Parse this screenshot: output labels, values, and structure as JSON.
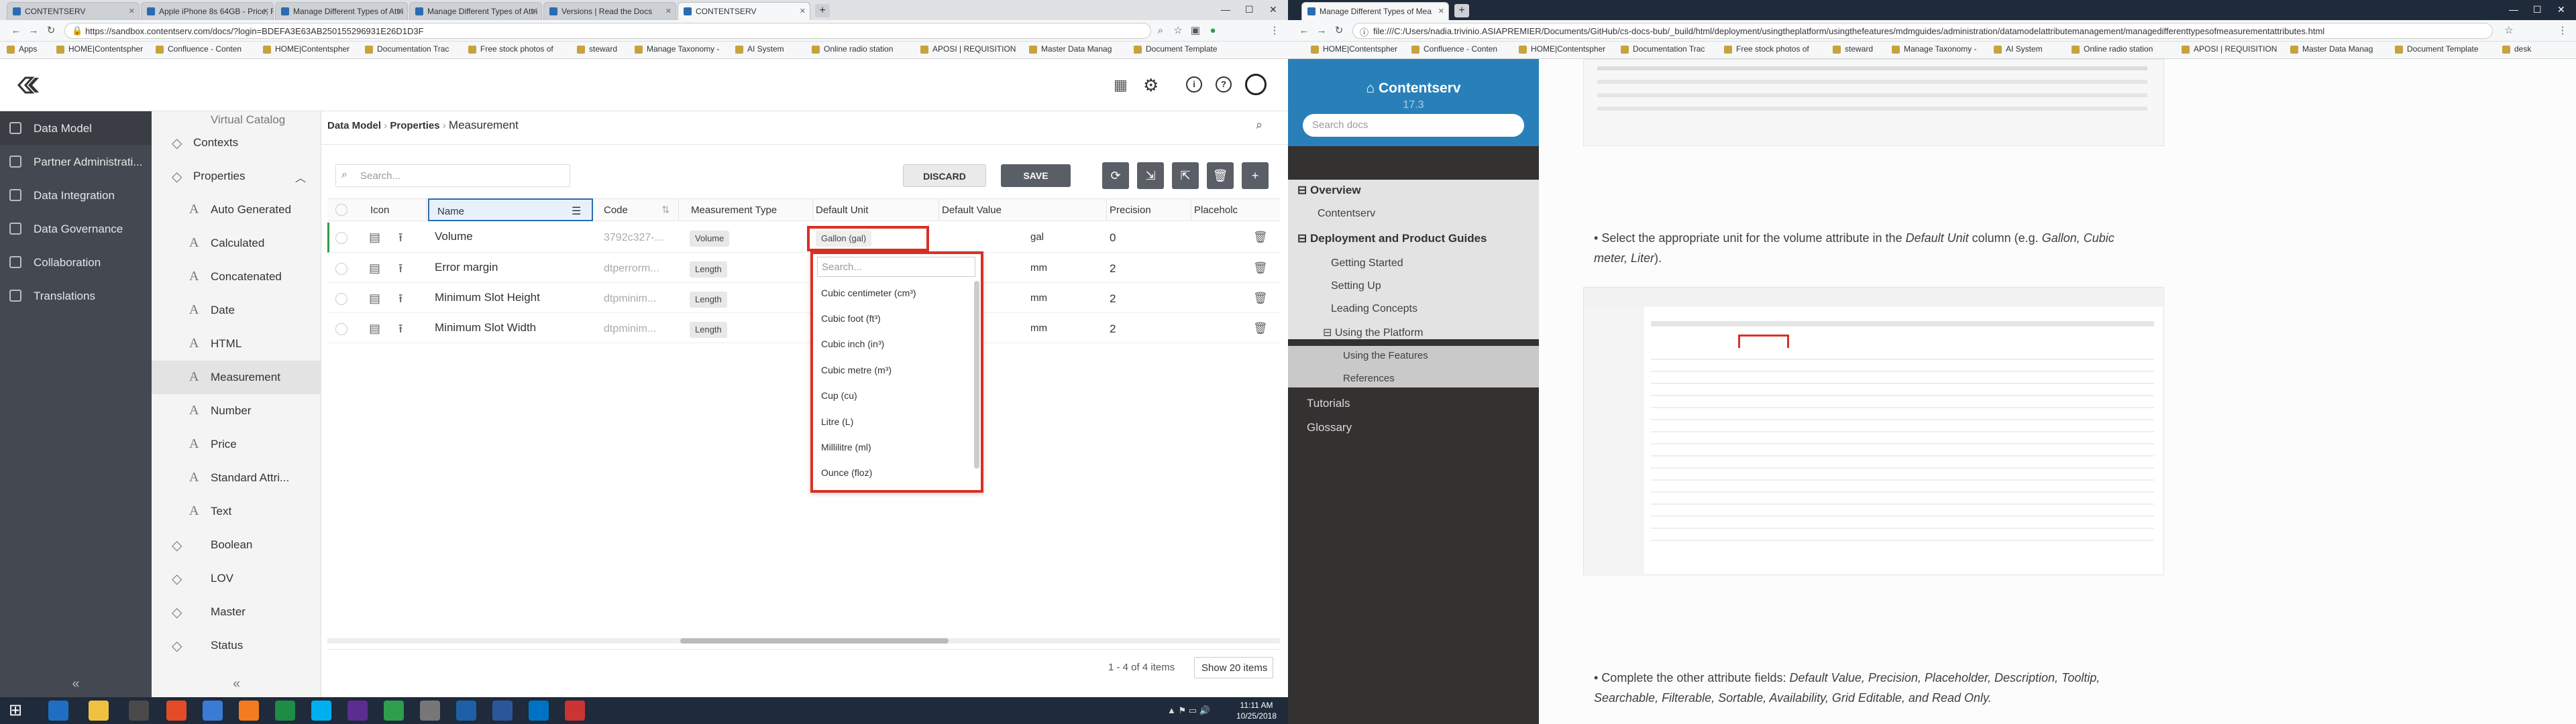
{
  "left_browser": {
    "tabs": [
      {
        "label": "CONTENTSERV"
      },
      {
        "label": "Apple iPhone 8s 64GB - Price, Fe"
      },
      {
        "label": "Manage Different Types of Attri"
      },
      {
        "label": "Manage Different Types of Attri"
      },
      {
        "label": "Versions | Read the Docs"
      },
      {
        "label": "CONTENTSERV"
      }
    ],
    "url": "https://sandbox.contentserv.com/docs/?login=BDEFA3E63AB250155296931E26D1D3F",
    "bookmarks": [
      "Apps",
      "HOME|Contentspher",
      "Confluence - Conten",
      "HOME|Contentspher",
      "Documentation Trac",
      "Free stock photos of",
      "steward",
      "Manage Taxonomy -",
      "AI System",
      "Online radio station",
      "APOSI | REQUISITION",
      "Master Data Manag",
      "Document Template"
    ]
  },
  "app": {
    "nav": [
      {
        "label": "Data Model",
        "active": true
      },
      {
        "label": "Partner Administrati..."
      },
      {
        "label": "Data Integration"
      },
      {
        "label": "Data Governance"
      },
      {
        "label": "Collaboration"
      },
      {
        "label": "Translations"
      }
    ],
    "tree": [
      {
        "label": "Virtual Catalog"
      },
      {
        "label": "Contexts"
      },
      {
        "label": "Properties"
      },
      {
        "label": "Auto Generated"
      },
      {
        "label": "Calculated"
      },
      {
        "label": "Concatenated"
      },
      {
        "label": "Date"
      },
      {
        "label": "HTML"
      },
      {
        "label": "Measurement",
        "active": true
      },
      {
        "label": "Number"
      },
      {
        "label": "Price"
      },
      {
        "label": "Standard Attri..."
      },
      {
        "label": "Text"
      },
      {
        "label": "Boolean"
      },
      {
        "label": "LOV"
      },
      {
        "label": "Master"
      },
      {
        "label": "Status"
      }
    ],
    "breadcrumb": [
      "Data Model",
      "Properties",
      "Measurement"
    ],
    "search_placeholder": "Search...",
    "discard_label": "DISCARD",
    "save_label": "SAVE",
    "columns": [
      "Icon",
      "Name",
      "Code",
      "Measurement Type",
      "Default Unit",
      "Default Value",
      "Precision",
      "Placeholc"
    ],
    "rows": [
      {
        "name": "Volume",
        "code": "3792c327-...",
        "type": "Volume",
        "unit": "Gallon (gal)",
        "default": "gal",
        "precision": "0"
      },
      {
        "name": "Error margin",
        "code": "dtperrorm...",
        "type": "Length",
        "unit": "",
        "default": "mm",
        "precision": "2"
      },
      {
        "name": "Minimum Slot Height",
        "code": "dtpminim...",
        "type": "Length",
        "unit": "",
        "default": "mm",
        "precision": "2"
      },
      {
        "name": "Minimum Slot Width",
        "code": "dtpminim...",
        "type": "Length",
        "unit": "",
        "default": "mm",
        "precision": "2"
      }
    ],
    "dropdown": {
      "placeholder": "Search...",
      "options": [
        "Cubic centimeter (cm³)",
        "Cubic foot (ft³)",
        "Cubic inch (in³)",
        "Cubic metre (m³)",
        "Cup (cu)",
        "Litre (L)",
        "Millilitre (ml)",
        "Ounce (floz)"
      ]
    },
    "pagination": "1 - 4 of 4 items",
    "page_size": "Show 20 items",
    "clock": {
      "time": "11:11 AM",
      "date": "10/25/2018"
    }
  },
  "right_browser": {
    "tab_label": "Manage Different Types of Mea",
    "url": "file:///C:/Users/nadia.trivinio.ASIAPREMIER/Documents/GitHub/cs-docs-bub/_build/html/deployment/usingtheplatform/usingthefeatures/mdmguides/administration/datamodelattributemanagement/managedifferenttypesofmeasurementattributes.html",
    "bookmarks": [
      "HOME|Contentspher",
      "Confluence - Conten",
      "HOME|Contentspher",
      "Documentation Trac",
      "Free stock photos of",
      "steward",
      "Manage Taxonomy -",
      "AI System",
      "Online radio station",
      "APOSI | REQUISITION",
      "Master Data Manag",
      "Document Template",
      "desk"
    ]
  },
  "docs": {
    "brand": "Contentserv",
    "version": "17.3",
    "search_placeholder": "Search docs",
    "nav": [
      {
        "label": "Overview",
        "level": 0
      },
      {
        "label": "Contentserv",
        "level": 1
      },
      {
        "label": "Deployment and Product Guides",
        "level": 0
      },
      {
        "label": "Getting Started",
        "level": 1
      },
      {
        "label": "Setting Up",
        "level": 1
      },
      {
        "label": "Leading Concepts",
        "level": 1
      },
      {
        "label": "Using the Platform",
        "level": 1
      },
      {
        "label": "Using the Features",
        "level": 2
      },
      {
        "label": "References",
        "level": 2
      },
      {
        "label": "Tutorials",
        "level": 0
      },
      {
        "label": "Glossary",
        "level": 0
      }
    ],
    "bullet1_pre": "Select the appropriate unit for the volume attribute in the ",
    "bullet1_em": "Default Unit",
    "bullet1_mid": " column (e.g. ",
    "bullet1_em2": "Gallon, Cubic meter, Liter",
    "bullet1_post": ").",
    "bullet2_pre": "Complete the other attribute fields: ",
    "bullet2_em": "Default Value, Precision, Placeholder, Description, Tooltip, Searchable, Filterable, Sortable, Availability, Grid Editable, and Read Only.",
    "bullet2_post": ""
  },
  "colors": {
    "nav_bg": "#444850",
    "docs_brand": "#2980b9",
    "highlight_red": "#d93025",
    "docs_nav_bg": "#343131"
  }
}
